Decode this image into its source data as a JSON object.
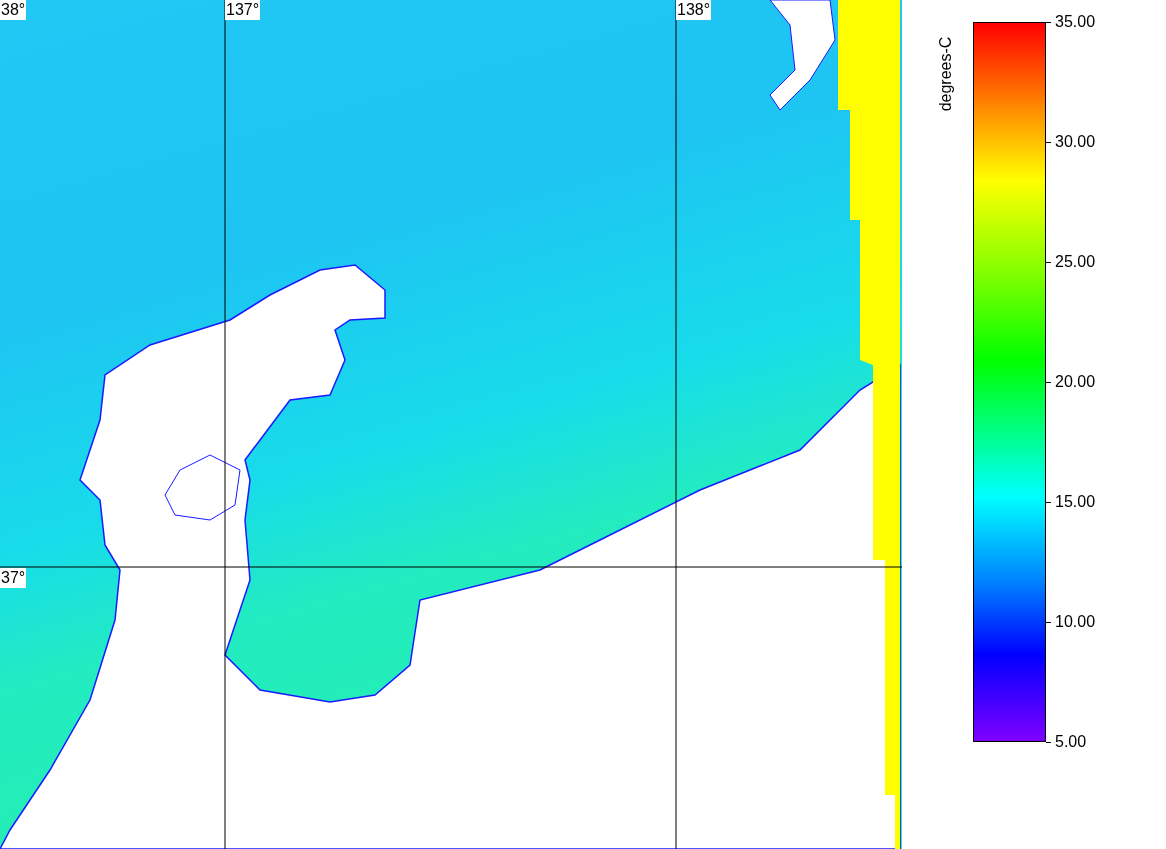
{
  "map": {
    "grid_labels": [
      {
        "text": "38°",
        "kind": "lat-top"
      },
      {
        "text": "137°",
        "kind": "lon-a"
      },
      {
        "text": "138°",
        "kind": "lon-b"
      },
      {
        "text": "37°",
        "kind": "lat-mid"
      }
    ]
  },
  "colorbar": {
    "title": "degrees-C",
    "ticks": [
      "35.00",
      "30.00",
      "25.00",
      "20.00",
      "15.00",
      "10.00",
      "5.00"
    ]
  }
}
